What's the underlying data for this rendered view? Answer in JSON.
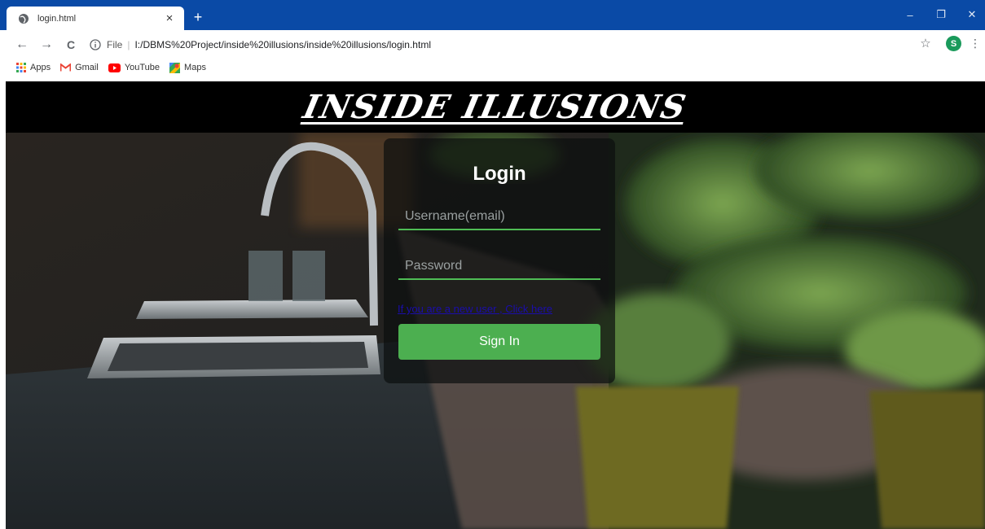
{
  "browser": {
    "tab_title": "login.html",
    "tab_close": "×",
    "new_tab": "+",
    "window_controls": {
      "minimize": "–",
      "restore": "❐",
      "close": "✕"
    },
    "nav": {
      "back": "←",
      "forward": "→",
      "reload": "C"
    },
    "address": {
      "scheme": "File",
      "separator": "|",
      "url": "I:/DBMS%20Project/inside%20illusions/inside%20illusions/login.html"
    },
    "star": "☆",
    "profile_initial": "S",
    "menu": "⋮",
    "bookmarks": [
      {
        "label": "Apps",
        "icon": "apps-grid-icon"
      },
      {
        "label": "Gmail",
        "icon": "gmail-icon"
      },
      {
        "label": "YouTube",
        "icon": "youtube-icon"
      },
      {
        "label": "Maps",
        "icon": "maps-icon"
      }
    ]
  },
  "page": {
    "site_title": "INSIDE ILLUSIONS",
    "login": {
      "title": "Login",
      "username_placeholder": "Username(email)",
      "password_placeholder": "Password",
      "signup_link": "If you are a new user , Click here",
      "signin_label": "Sign In"
    }
  },
  "colors": {
    "tabbar": "#0a4aa6",
    "accent_green": "#4caf50",
    "link": "#1a0dab",
    "card_bg": "rgba(12,14,14,0.70)"
  }
}
